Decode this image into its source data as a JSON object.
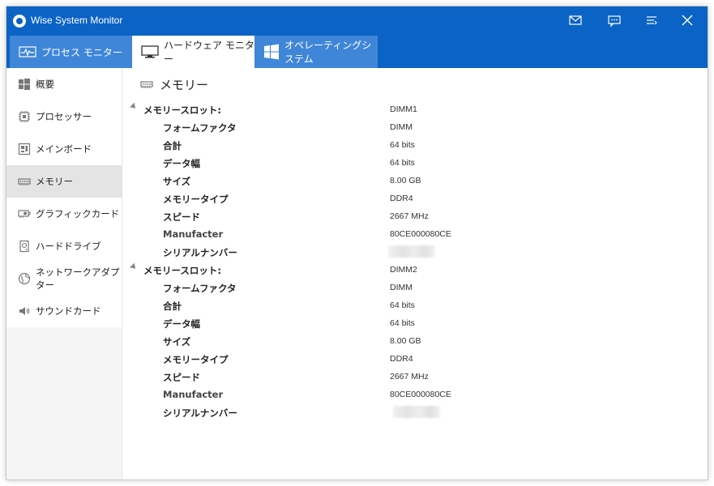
{
  "window": {
    "title": "Wise System Monitor"
  },
  "titlebar_buttons": [
    {
      "name": "mail-button",
      "icon": "mail-icon"
    },
    {
      "name": "feedback-button",
      "icon": "chat-icon"
    },
    {
      "name": "menu-button",
      "icon": "menu-icon"
    },
    {
      "name": "close-button",
      "icon": "close-icon"
    }
  ],
  "tabs": [
    {
      "label": "プロセス モニター",
      "icon": "activity-icon"
    },
    {
      "label": "ハードウェア モニター",
      "icon": "monitor-icon",
      "active": true
    },
    {
      "label": "オペレーティングシステム",
      "icon": "windows-icon"
    }
  ],
  "sidebar": {
    "items": [
      {
        "label": "概要",
        "icon": "windows-icon"
      },
      {
        "label": "プロセッサー",
        "icon": "cpu-icon"
      },
      {
        "label": "メインボード",
        "icon": "motherboard-icon"
      },
      {
        "label": "メモリー",
        "icon": "memory-icon",
        "active": true
      },
      {
        "label": "グラフィックカード",
        "icon": "gpu-icon"
      },
      {
        "label": "ハードドライブ",
        "icon": "harddrive-icon"
      },
      {
        "label": "ネットワークアダプター",
        "icon": "globe-icon"
      },
      {
        "label": "サウンドカード",
        "icon": "speaker-icon"
      }
    ]
  },
  "main": {
    "section_title": "メモリー",
    "slots": [
      {
        "label": "メモリースロット:",
        "value": "DIMM1",
        "props": [
          {
            "label": "フォームファクタ",
            "value": "DIMM"
          },
          {
            "label": "合計",
            "value": "64 bits"
          },
          {
            "label": "データ幅",
            "value": "64 bits"
          },
          {
            "label": "サイズ",
            "value": "8.00 GB"
          },
          {
            "label": "メモリータイプ",
            "value": "DDR4"
          },
          {
            "label": "スピード",
            "value": "2667 MHz"
          },
          {
            "label": "Manufacter",
            "value": "80CE000080CE"
          },
          {
            "label": "シリアルナンバー",
            "value": ""
          }
        ]
      },
      {
        "label": "メモリースロット:",
        "value": "DIMM2",
        "props": [
          {
            "label": "フォームファクタ",
            "value": "DIMM"
          },
          {
            "label": "合計",
            "value": "64 bits"
          },
          {
            "label": "データ幅",
            "value": "64 bits"
          },
          {
            "label": "サイズ",
            "value": "8.00 GB"
          },
          {
            "label": "メモリータイプ",
            "value": "DDR4"
          },
          {
            "label": "スピード",
            "value": "2667 MHz"
          },
          {
            "label": "Manufacter",
            "value": "80CE000080CE"
          },
          {
            "label": "シリアルナンバー",
            "value": ""
          }
        ]
      }
    ]
  },
  "colors": {
    "titlebar": "#0b63c5",
    "tab_inactive": "#3f86d8",
    "sidebar_active": "#e4e4e4"
  }
}
